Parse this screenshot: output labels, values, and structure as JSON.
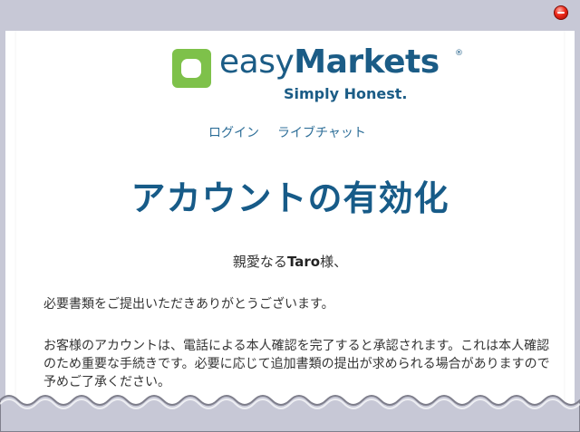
{
  "brand": {
    "name_light": "easy",
    "name_bold": "Markets",
    "registered_mark": "®",
    "tagline": "Simply Honest.",
    "color": "#1b5c86",
    "logo_color": "#7ec14a"
  },
  "nav": {
    "login": "ログイン",
    "live_chat": "ライブチャット"
  },
  "email": {
    "headline": "アカウントの有効化",
    "greeting_prefix": "親愛なる",
    "user_name": "Taro",
    "greeting_suffix": "様、",
    "paragraph1": "必要書類をご提出いただきありがとうございます。",
    "paragraph2": "お客様のアカウントは、電話による本人確認を完了すると承認されます。これは本人確認のため重要な手続きです。必要に応じて追加書類の提出が求められる場合がありますので予めご了承ください。"
  },
  "window": {
    "close_icon": "close-icon",
    "accent_close": "#e8261a"
  }
}
